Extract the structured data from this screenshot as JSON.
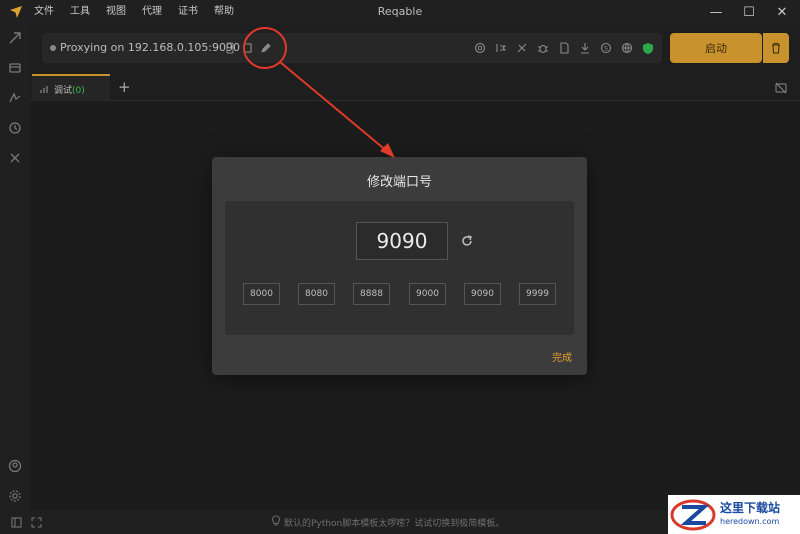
{
  "window": {
    "title": "Reqable",
    "menu": [
      "文件",
      "工具",
      "视图",
      "代理",
      "证书",
      "帮助"
    ],
    "controls": {
      "minimize": "—",
      "maximize": "☐",
      "close": "✕"
    }
  },
  "proxy": {
    "status_text": "Proxying on 192.168.0.105:9090",
    "start_label": "启动",
    "status_color": "#8a8a8a",
    "accent": "#c8922c"
  },
  "tabs": [
    {
      "label": "调试",
      "count": "(0)"
    }
  ],
  "tab_count_color": "#3dbb55",
  "modal": {
    "title": "修改端口号",
    "port_value": "9090",
    "presets": [
      "8000",
      "8080",
      "8888",
      "9000",
      "9090",
      "9999"
    ],
    "done_label": "完成"
  },
  "statusbar": {
    "tip": "默认的Python脚本模板太啰嗦？试试切换到极简模板。"
  },
  "annotation": {
    "color": "#e03a2a"
  },
  "watermark": {
    "text": "这里下载站",
    "sub": "heredown.com"
  }
}
